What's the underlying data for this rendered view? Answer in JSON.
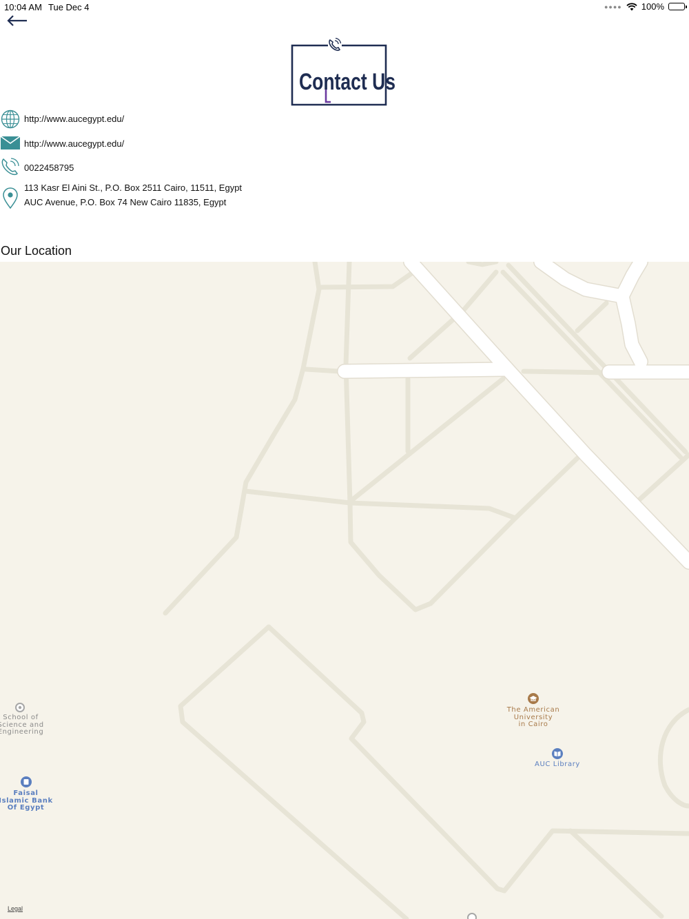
{
  "status_bar": {
    "time": "10:04 AM",
    "date": "Tue Dec 4",
    "battery": "100%"
  },
  "logo": {
    "text": "Contact Us",
    "color": "#1f2d52",
    "accent": "#6b3aa0"
  },
  "contacts": {
    "website": "http://www.aucegypt.edu/",
    "email": "http://www.aucegypt.edu/",
    "phone": "0022458795",
    "address_line_1": "113 Kasr El Aini St., P.O. Box 2511 Cairo, 11511, Egypt",
    "address_line_2": "AUC Avenue, P.O. Box 74 New Cairo 11835, Egypt"
  },
  "location": {
    "title": "Our Location"
  },
  "map": {
    "background": "#f6f3ea",
    "pois": {
      "school": "School of\nScience and\nEngineering",
      "bank": "Faisal\nIslamic Bank\nOf Egypt",
      "university": "The American\nUniversity\nin Cairo",
      "library": "AUC Library"
    },
    "legal": "Legal"
  },
  "colors": {
    "icon_teal": "#3a8f95",
    "nav_arrow": "#1f2d52",
    "poi_blue": "#5b7fbf",
    "poi_brown": "#a87a4a",
    "poi_gray": "#8a8a8a"
  }
}
